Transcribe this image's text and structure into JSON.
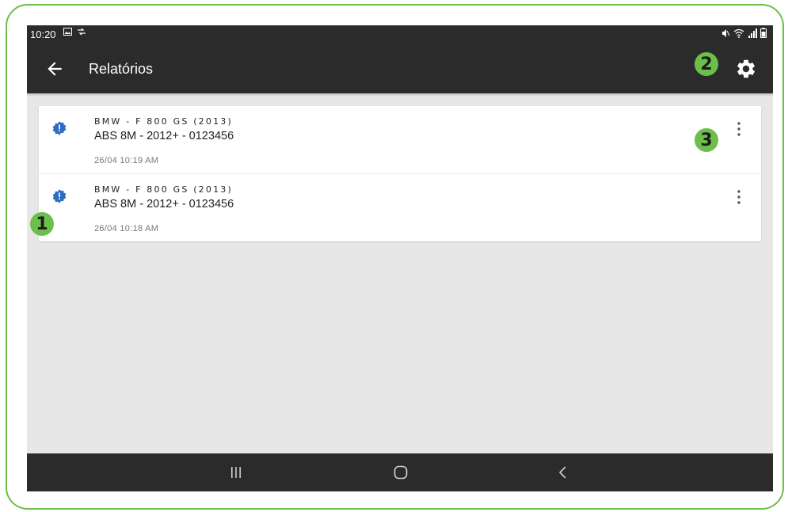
{
  "status_bar": {
    "time": "10:20",
    "left_icons": [
      "image-icon",
      "sync-icon"
    ],
    "right_icons": [
      "mute-vibrate-icon",
      "wifi-icon",
      "signal-icon",
      "battery-icon"
    ]
  },
  "app_bar": {
    "title": "Relatórios",
    "back_icon": "arrow-left-icon",
    "settings_icon": "gear-icon"
  },
  "reports": [
    {
      "vehicle": "BMW - F 800 GS (2013)",
      "module": "ABS 8M - 2012+ - 0123456",
      "date": "26/04 10:19 AM",
      "status_icon": "alert-badge-icon",
      "menu_icon": "more-vert-icon"
    },
    {
      "vehicle": "BMW - F 800 GS (2013)",
      "module": "ABS 8M - 2012+ - 0123456",
      "date": "26/04 10:18 AM",
      "status_icon": "alert-badge-icon",
      "menu_icon": "more-vert-icon"
    }
  ],
  "nav_bar": {
    "buttons": [
      "recent-apps-icon",
      "home-icon",
      "back-icon"
    ]
  },
  "callouts": [
    "1",
    "2",
    "3"
  ],
  "colors": {
    "bar_background": "#2b2b2b",
    "screen_background": "#e6e7e6",
    "accent_green": "#6cbf4a",
    "alert_blue": "#2f6cc1"
  }
}
